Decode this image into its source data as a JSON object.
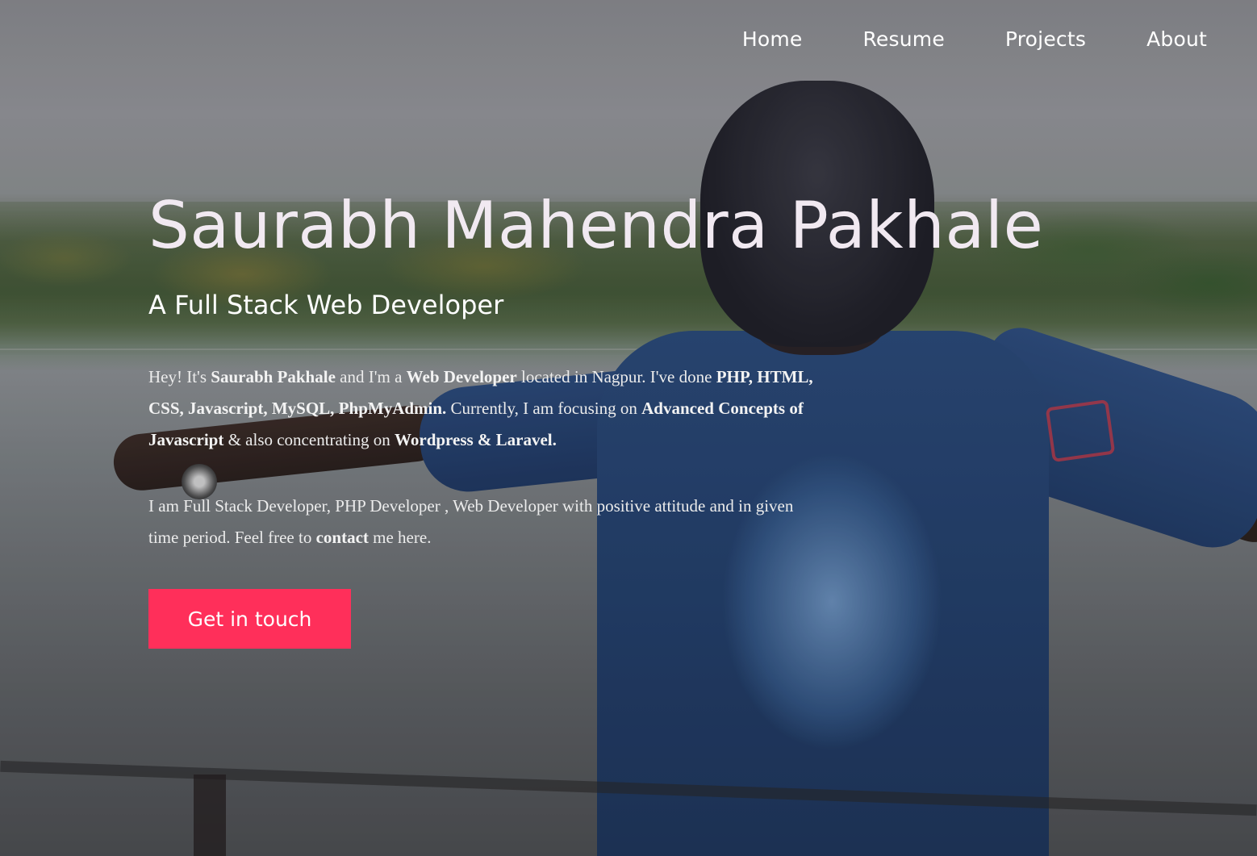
{
  "nav": {
    "items": [
      {
        "label": "Home"
      },
      {
        "label": "Resume"
      },
      {
        "label": "Projects"
      },
      {
        "label": "About"
      }
    ]
  },
  "hero": {
    "name": "Saurabh Mahendra Pakhale",
    "subtitle": "A Full Stack Web Developer",
    "bio1": {
      "t1": "Hey! It's ",
      "b1": "Saurabh Pakhale",
      "t2": " and I'm a ",
      "b2": "Web Developer",
      "t3": " located in Nagpur. I've done ",
      "b3": "PHP, HTML, CSS, Javascript, MySQL, PhpMyAdmin.",
      "t4": " Currently, I am focusing on ",
      "b4": "Advanced Concepts of Javascript",
      "t5": " & also concentrating on ",
      "b5": "Wordpress & Laravel."
    },
    "bio2": {
      "t1": "I am Full Stack Developer, PHP Developer , Web Developer with positive attitude and in given time period. Feel free to ",
      "b1": "contact",
      "t2": " me here."
    },
    "cta_label": "Get in touch"
  },
  "colors": {
    "accent": "#ff2f5a",
    "text": "#ffffff"
  }
}
